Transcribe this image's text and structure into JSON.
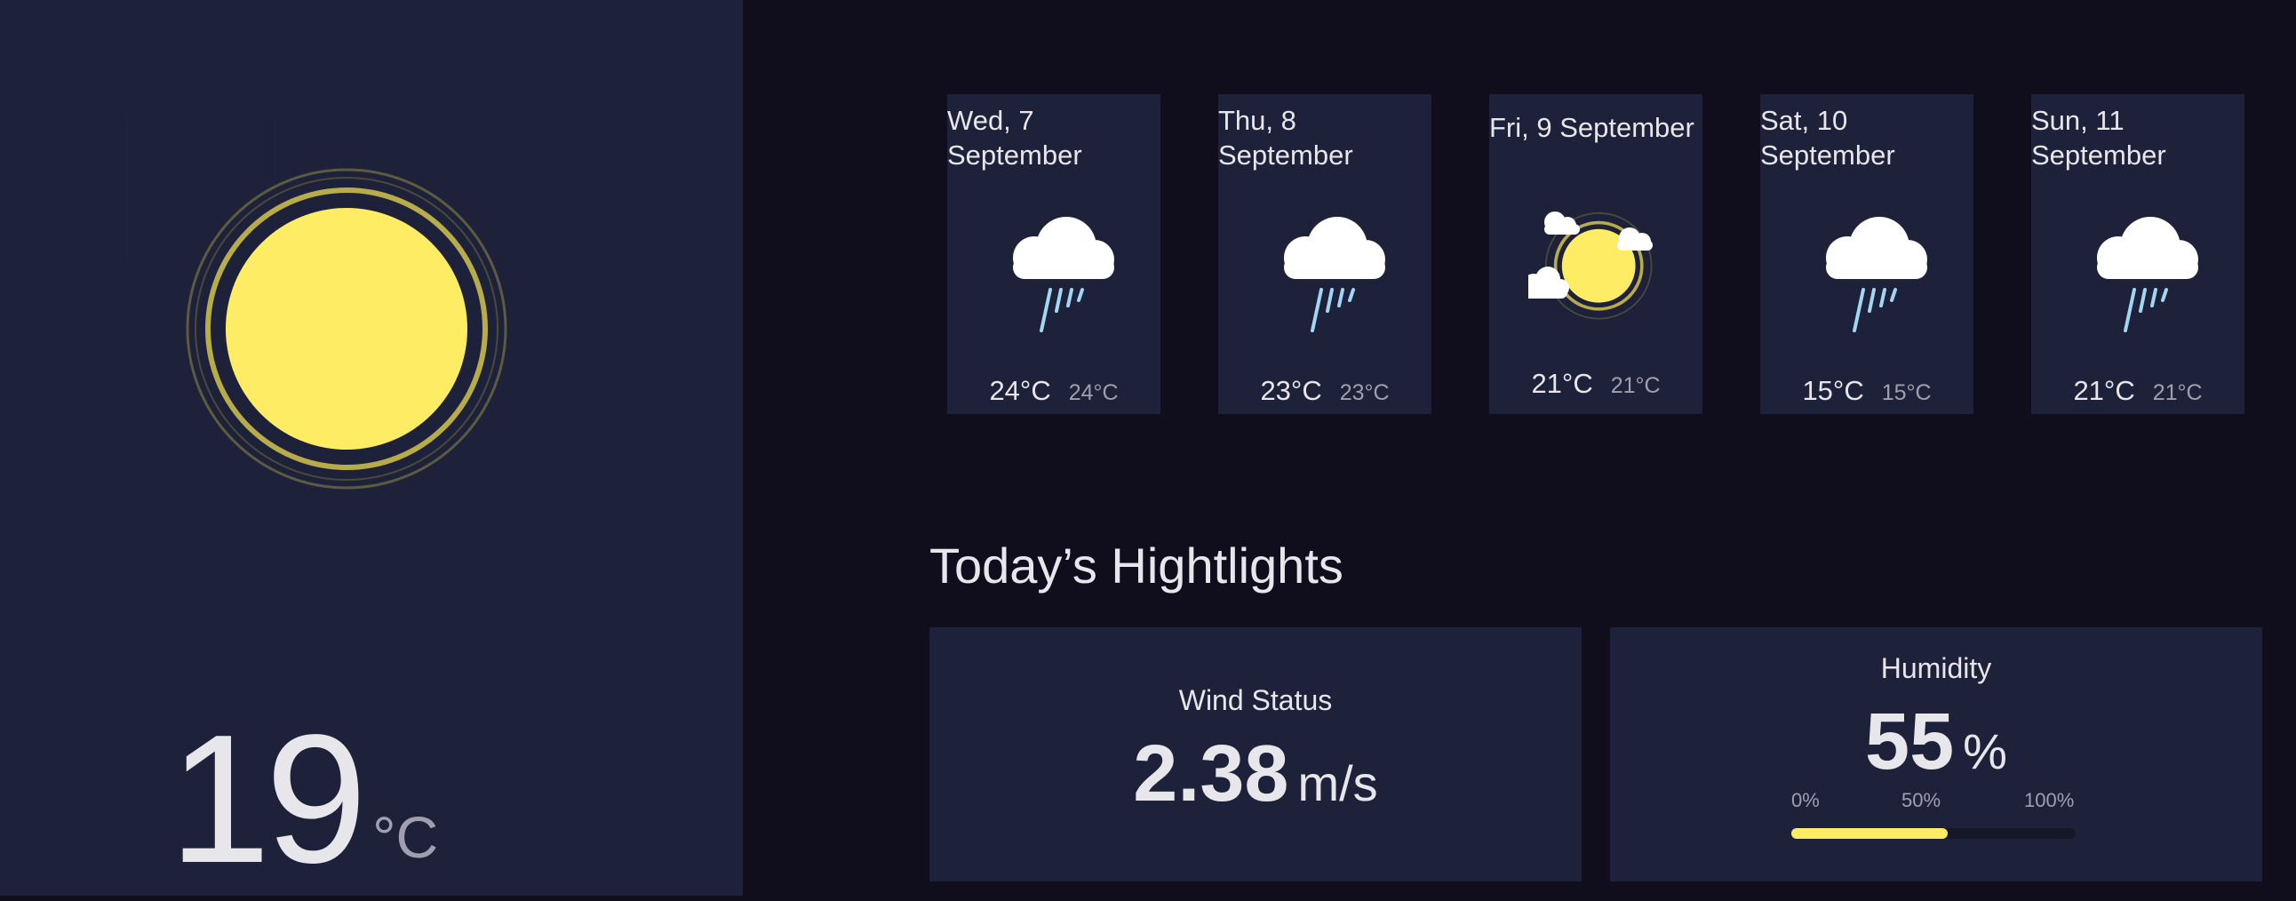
{
  "current": {
    "temp": "19",
    "unit": "°C",
    "icon": "sun-icon"
  },
  "forecast": [
    {
      "date": "Wed, 7 September",
      "icon": "rain-cloud-icon",
      "max": "24°C",
      "min": "24°C"
    },
    {
      "date": "Thu, 8 September",
      "icon": "rain-cloud-icon",
      "max": "23°C",
      "min": "23°C"
    },
    {
      "date": "Fri, 9 September",
      "icon": "sun-clouds-icon",
      "max": "21°C",
      "min": "21°C"
    },
    {
      "date": "Sat, 10 September",
      "icon": "rain-cloud-icon",
      "max": "15°C",
      "min": "15°C"
    },
    {
      "date": "Sun, 11 September",
      "icon": "rain-cloud-icon",
      "max": "21°C",
      "min": "21°C"
    }
  ],
  "highlights": {
    "title": "Today’s Hightlights",
    "wind": {
      "label": "Wind Status",
      "value": "2.38",
      "unit": "m/s"
    },
    "humidity": {
      "label": "Humidity",
      "value": "55",
      "unit": "%",
      "percent": 55,
      "scale": [
        "0%",
        "50%",
        "100%"
      ]
    }
  },
  "colors": {
    "background": "#100e1d",
    "panel": "#1e213a",
    "sun": "#ffec65",
    "text": "#e7e7eb",
    "muted": "#a09fb1"
  }
}
